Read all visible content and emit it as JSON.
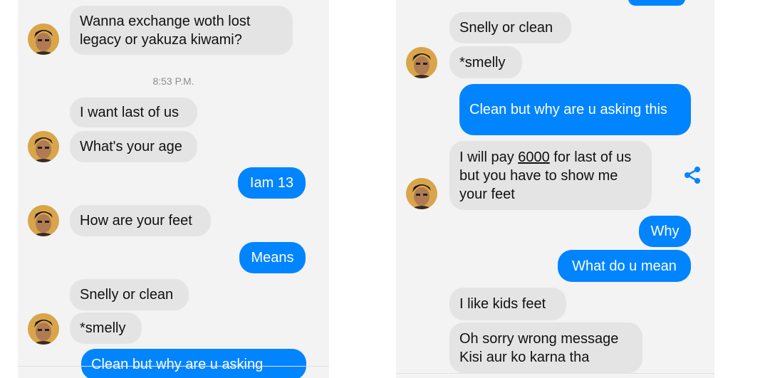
{
  "left_panel": {
    "messages": [
      {
        "text": "Wanna exchange woth lost legacy or yakuza kiwami?"
      },
      {
        "text": "I want last of us"
      },
      {
        "text": "What's your age"
      },
      {
        "text": "Iam 13"
      },
      {
        "text": "How are your feet"
      },
      {
        "text": "Means"
      },
      {
        "text": "Snelly or clean"
      },
      {
        "text": "*smelly"
      },
      {
        "text": "Clean but why are u asking"
      }
    ],
    "timestamp": "8:53 P.M."
  },
  "right_panel": {
    "messages": [
      {
        "text": "Snelly or clean"
      },
      {
        "text": "*smelly"
      },
      {
        "text": "Clean but why are u asking this"
      },
      {
        "pre": "I will pay ",
        "amount": "6000",
        "post": " for last of us but you have to show me your feet"
      },
      {
        "text": "Why"
      },
      {
        "text": "What do u mean"
      },
      {
        "text": "I like kids feet"
      },
      {
        "text": "Oh sorry wrong message Kisi aur ko karna tha"
      }
    ]
  },
  "colors": {
    "outgoing_bubble": "#0084ff",
    "incoming_bubble": "#e4e4e4",
    "background": "#f3f3f3",
    "share_icon": "#0084ff"
  },
  "icons": {
    "avatar": "user-avatar",
    "share": "share-icon"
  }
}
